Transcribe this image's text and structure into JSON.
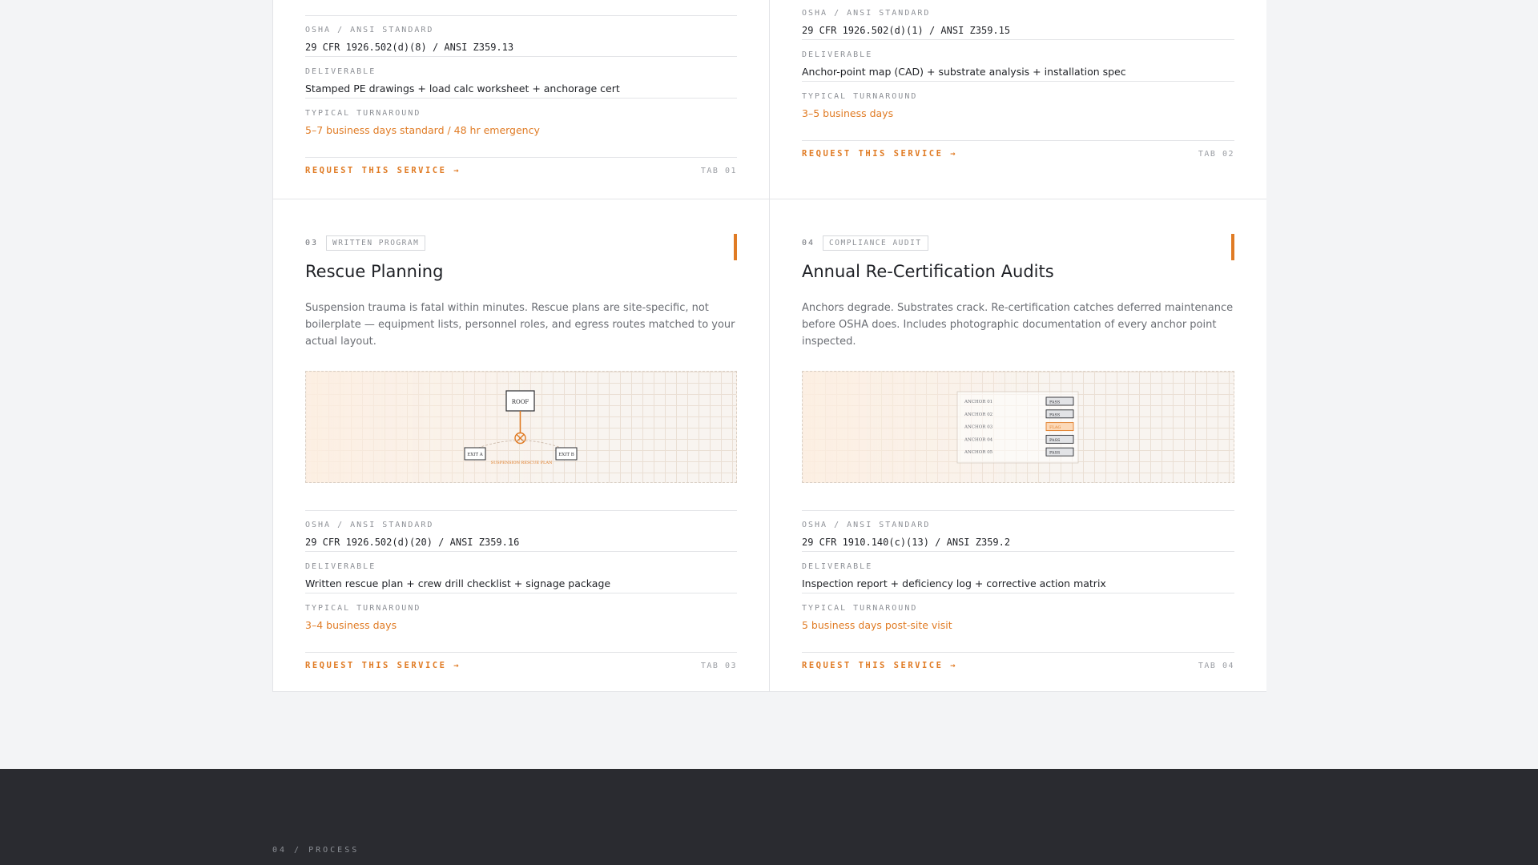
{
  "cards": [
    {
      "tab": "TAB 01",
      "cta": "REQUEST THIS SERVICE →",
      "specs": [
        {
          "label": "OSHA / ANSI STANDARD",
          "value": "29 CFR 1926.502(d)(8) / ANSI Z359.13"
        },
        {
          "label": "DELIVERABLE",
          "value": "Stamped PE drawings + load calc worksheet + anchorage cert"
        },
        {
          "label": "TYPICAL TURNAROUND",
          "value": "5–7 business days standard / 48 hr emergency"
        }
      ]
    },
    {
      "tab": "TAB 02",
      "cta": "REQUEST THIS SERVICE →",
      "specs": [
        {
          "label": "OSHA / ANSI STANDARD",
          "value": "29 CFR 1926.502(d)(1) / ANSI Z359.15"
        },
        {
          "label": "DELIVERABLE",
          "value": "Anchor-point map (CAD) + substrate analysis + installation spec"
        },
        {
          "label": "TYPICAL TURNAROUND",
          "value": "3–5 business days"
        }
      ]
    },
    {
      "num": "03",
      "tag": "WRITTEN PROGRAM",
      "title": "Rescue Planning",
      "desc": "Suspension trauma is fatal within minutes. Rescue plans are site-specific, not boilerplate — equipment lists, personnel roles, and egress routes matched to your actual layout.",
      "diagram": {
        "roof": "ROOF",
        "exit_a": "EXIT A",
        "exit_b": "EXIT B",
        "caption": "SUSPENSION RESCUE PLAN"
      },
      "tab": "TAB 03",
      "cta": "REQUEST THIS SERVICE →",
      "specs": [
        {
          "label": "OSHA / ANSI STANDARD",
          "value": "29 CFR 1926.502(d)(20) / ANSI Z359.16"
        },
        {
          "label": "DELIVERABLE",
          "value": "Written rescue plan + crew drill checklist + signage package"
        },
        {
          "label": "TYPICAL TURNAROUND",
          "value": "3–4 business days"
        }
      ]
    },
    {
      "num": "04",
      "tag": "COMPLIANCE AUDIT",
      "title": "Annual Re-Certification Audits",
      "desc": "Anchors degrade. Substrates crack. Re-certification catches deferred maintenance before OSHA does. Includes photographic documentation of every anchor point inspected.",
      "audit_rows": [
        {
          "name": "ANCHOR 01",
          "status": "PASS"
        },
        {
          "name": "ANCHOR 02",
          "status": "PASS"
        },
        {
          "name": "ANCHOR 03",
          "status": "FLAG"
        },
        {
          "name": "ANCHOR 04",
          "status": "PASS"
        },
        {
          "name": "ANCHOR 05",
          "status": "PASS"
        }
      ],
      "tab": "TAB 04",
      "cta": "REQUEST THIS SERVICE →",
      "specs": [
        {
          "label": "OSHA / ANSI STANDARD",
          "value": "29 CFR 1910.140(c)(13) / ANSI Z359.2"
        },
        {
          "label": "DELIVERABLE",
          "value": "Inspection report + deficiency log + corrective action matrix"
        },
        {
          "label": "TYPICAL TURNAROUND",
          "value": "5 business days post-site visit"
        }
      ]
    }
  ],
  "next_section_label": "04 / PROCESS",
  "colors": {
    "accent": "#e07b24",
    "footer_bg": "#2a2b30",
    "page_bg": "#f3f4f6"
  }
}
